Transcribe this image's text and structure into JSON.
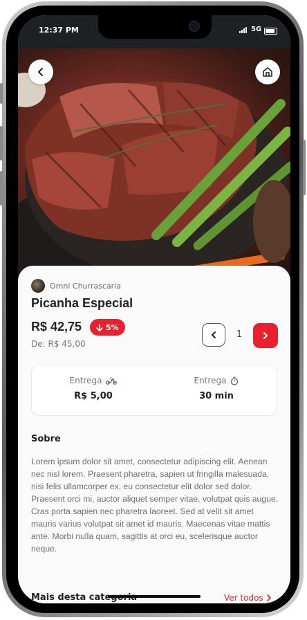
{
  "status_bar": {
    "time": "12:37 PM",
    "network": "5G"
  },
  "hero": {
    "image": "picanha steak with asparagus"
  },
  "product": {
    "restaurant": "Omni Churrascaria",
    "name": "Picanha Especial",
    "price": "R$ 42,75",
    "discount": "5%",
    "old_price": "De: R$ 45,00",
    "quantity": "1"
  },
  "info": {
    "delivery_fee_label": "Entrega",
    "delivery_fee_value": "R$ 5,00",
    "delivery_time_label": "Entrega",
    "delivery_time_value": "30 min"
  },
  "about": {
    "title": "Sobre",
    "text": "Lorem ipsum dolor sit amet, consectetur adipiscing elit. Aenean nec nisl lorem. Praesent pharetra, sapien ut fringilla malesuada, nisi felis ullamcorper ex, eu consectetur elit dolor sed dolor. Praesent orci mi, auctor aliquet semper vitae, volutpat quis augue. Cras porta sapien nec pharetra laoreet. Sed at velit sit amet mauris varius volutpat sit amet id mauris. Maecenas vitae mattis ante. Morbi nulla quam, sagittis at orci eu, scelerisque auctor neque."
  },
  "more": {
    "title": "Mais desta categoria",
    "see_all": "Ver todos"
  },
  "colors": {
    "accent": "#e8212e",
    "text": "#222222",
    "muted": "#6e6e6e",
    "statusbar": "#1d2124"
  },
  "icons": {
    "back": "chevron-left-icon",
    "home": "home-icon",
    "discount": "arrow-down-icon",
    "decrease": "chevron-left-icon",
    "increase": "chevron-right-icon",
    "delivery": "scooter-icon",
    "time": "stopwatch-icon"
  }
}
